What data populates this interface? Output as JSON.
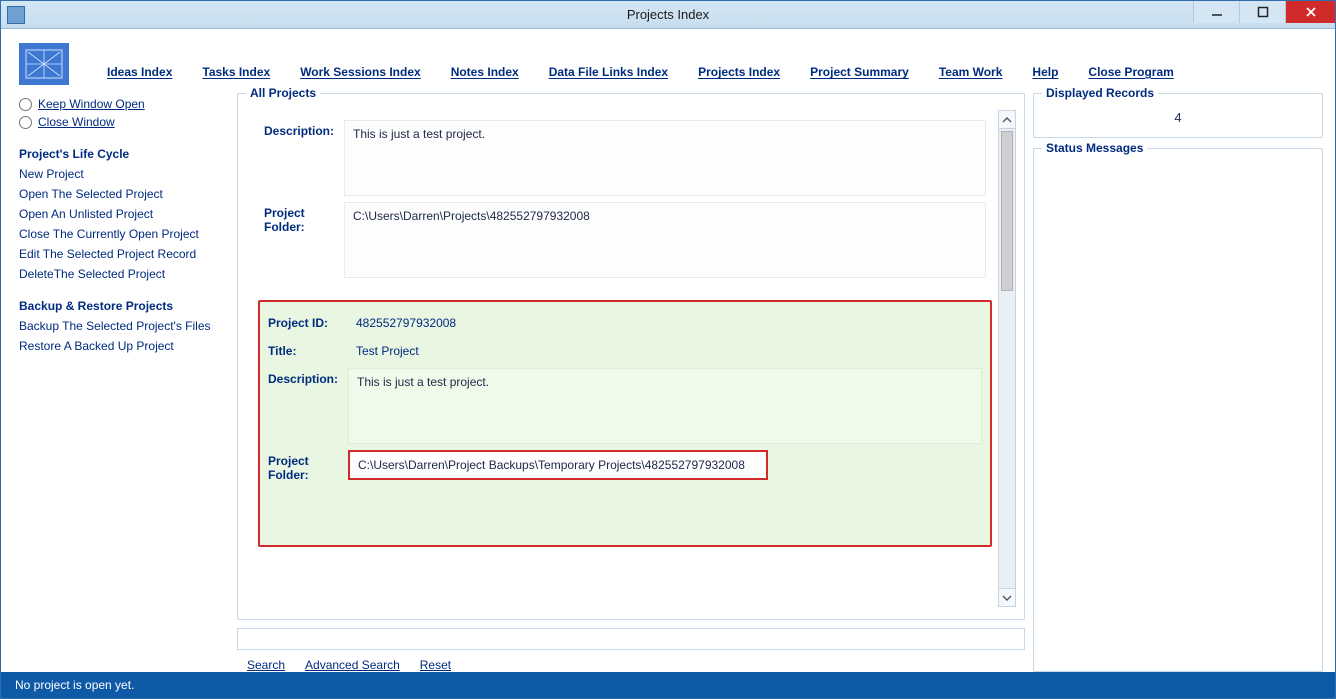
{
  "window": {
    "title": "Projects Index"
  },
  "menu": {
    "items": [
      "Ideas Index",
      "Tasks Index",
      "Work Sessions Index",
      "Notes Index",
      "Data File Links Index",
      "Projects Index",
      "Project Summary",
      "Team Work",
      "Help",
      "Close Program"
    ]
  },
  "sidebar": {
    "keep_open_label": "Keep Window Open",
    "close_window_label": "Close Window",
    "lifecycle_header": "Project's Life Cycle",
    "lifecycle": [
      "New Project",
      "Open The Selected Project",
      "Open An Unlisted Project",
      "Close The Currently Open Project",
      "Edit The Selected Project Record",
      "DeleteThe Selected Project"
    ],
    "backup_header": "Backup & Restore Projects",
    "backup": [
      "Backup The Selected Project's Files",
      "Restore A Backed Up Project"
    ]
  },
  "projects_box": {
    "legend": "All Projects",
    "labels": {
      "description": "Description:",
      "project_folder": "Project Folder:",
      "project_id": "Project ID:",
      "title": "Title:"
    },
    "card_top": {
      "description": "This is just a test project.",
      "folder": "C:\\Users\\Darren\\Projects\\482552797932008"
    },
    "card_selected": {
      "project_id": "482552797932008",
      "title": "Test Project",
      "description": "This is just a test project.",
      "folder": "C:\\Users\\Darren\\Project Backups\\Temporary Projects\\482552797932008"
    }
  },
  "search": {
    "search_label": "Search",
    "advanced_label": "Advanced Search",
    "reset_label": "Reset"
  },
  "rightcol": {
    "displayed_legend": "Displayed Records",
    "displayed_value": "4",
    "status_legend": "Status Messages"
  },
  "statusbar": {
    "text": "No project is open yet."
  }
}
